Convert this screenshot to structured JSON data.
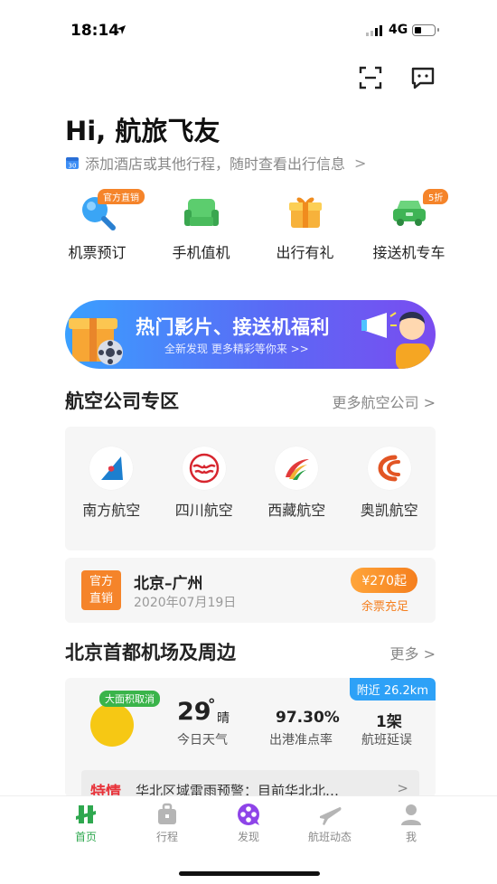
{
  "status_bar": {
    "time": "18:14",
    "network": "4G"
  },
  "header": {
    "greeting": "Hi, 航旅飞友",
    "add_trip_text": "添加酒店或其他行程，随时查看出行信息",
    "add_trip_chevron": ">",
    "scan_icon": "scan-icon",
    "message_icon": "message-icon"
  },
  "quick_actions": [
    {
      "label": "机票预订",
      "badge": "官方直销",
      "icon": "search-icon"
    },
    {
      "label": "手机值机",
      "badge": "",
      "icon": "seat-icon"
    },
    {
      "label": "出行有礼",
      "badge": "",
      "icon": "gift-icon"
    },
    {
      "label": "接送机专车",
      "badge": "5折",
      "icon": "car-icon"
    }
  ],
  "banner": {
    "title": "热门影片、接送机福利",
    "subtitle": "全新发现 更多精彩等你来 >>"
  },
  "airline_section": {
    "title": "航空公司专区",
    "more": "更多航空公司 >",
    "airlines": [
      {
        "name": "南方航空"
      },
      {
        "name": "四川航空"
      },
      {
        "name": "西藏航空"
      },
      {
        "name": "奥凯航空"
      }
    ]
  },
  "deal": {
    "tag_line1": "官方",
    "tag_line2": "直销",
    "route": "北京–广州",
    "date": "2020年07月19日",
    "price": "¥270起",
    "stock": "余票充足"
  },
  "airport_section": {
    "title": "北京首都机场及周边",
    "more": "更多 >",
    "near_badge": "附近 26.2km",
    "cancel_badge": "大面积取消",
    "temperature": "29",
    "degree": "°",
    "condition": "晴",
    "weather_label": "今日天气",
    "punctuality_value": "97.30%",
    "punctuality_label": "出港准点率",
    "delay_value": "1架",
    "delay_label": "航班延误",
    "alert_tag": "特情",
    "alert_text": "华北区域雷雨预警：目前华北北…",
    "alert_chevron": ">"
  },
  "tabbar": [
    {
      "label": "首页",
      "active": true
    },
    {
      "label": "行程",
      "active": false
    },
    {
      "label": "发现",
      "active": false
    },
    {
      "label": "航班动态",
      "active": false
    },
    {
      "label": "我",
      "active": false
    }
  ],
  "colors": {
    "brand_green": "#2fa84f",
    "accent_orange": "#f5842a",
    "info_blue": "#2da1f7",
    "alert_red": "#e8333a"
  }
}
